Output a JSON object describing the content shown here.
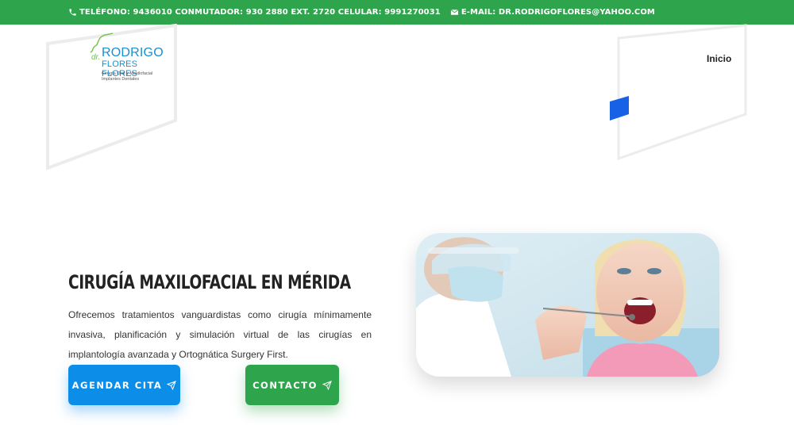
{
  "topbar": {
    "phone": "TELÉFONO: 9436010 CONMUTADOR: 930 2880 EXT. 2720 CELULAR: 9991270031",
    "email": "E-MAIL: DR.RODRIGOFLORES@YAHOO.COM"
  },
  "logo": {
    "dr": "dr.",
    "name_line1": "RODRIGO",
    "name_line2": "FLORES FLORES",
    "subtitle_line1": "Cirugía Oral y Maxilofacial",
    "subtitle_line2": "Implantes Dentales"
  },
  "nav": {
    "inicio": "Inicio"
  },
  "hero": {
    "title": "CIRUGÍA MAXILOFACIAL EN MÉRIDA",
    "description": "Ofrecemos tratamientos vanguardistas como cirugía mínimamente invasiva, planificación y simulación virtual de las cirugías en implantología avanzada y Ortognática Surgery First.",
    "btn_agendar": "AGENDAR CITA",
    "btn_contacto": "CONTACTO"
  },
  "colors": {
    "topbar_green": "#2ea54c",
    "agendar_blue": "#0c8de8",
    "contacto_green": "#2ea54c",
    "accent_blue": "#1761e6"
  },
  "icons": {
    "phone": "phone-icon",
    "email": "envelope-icon",
    "send": "paper-plane-icon"
  }
}
